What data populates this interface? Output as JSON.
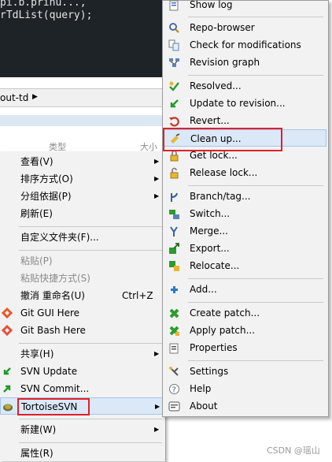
{
  "editor": {
    "line1": "pi.b.prinu..., ",
    "line2": "rTdList(query);"
  },
  "address_bar": {
    "path": "out-td"
  },
  "columns": {
    "type": "类型",
    "size": "大小"
  },
  "context_menu": {
    "view": "查看(V)",
    "sort": "排序方式(O)",
    "group": "分组依据(P)",
    "refresh": "刷新(E)",
    "customize": "自定义文件夹(F)...",
    "paste": "粘贴(P)",
    "paste_shortcut": "粘贴快捷方式(S)",
    "undo_rename": "撤消 重命名(U)",
    "undo_shortcut": "Ctrl+Z",
    "git_gui": "Git GUI Here",
    "git_bash": "Git Bash Here",
    "share": "共享(H)",
    "svn_update": "SVN Update",
    "svn_commit": "SVN Commit...",
    "tortoise": "TortoiseSVN",
    "new": "新建(W)",
    "properties": "属性(R)"
  },
  "submenu": {
    "show_log": "Show log",
    "repo_browser": "Repo-browser",
    "check_mod": "Check for modifications",
    "rev_graph": "Revision graph",
    "resolved": "Resolved...",
    "update_to_rev": "Update to revision...",
    "revert": "Revert...",
    "clean_up": "Clean up...",
    "get_lock": "Get lock...",
    "release_lock": "Release lock...",
    "branch_tag": "Branch/tag...",
    "switch": "Switch...",
    "merge": "Merge...",
    "export": "Export...",
    "relocate": "Relocate...",
    "add": "Add...",
    "create_patch": "Create patch...",
    "apply_patch": "Apply patch...",
    "properties": "Properties",
    "settings": "Settings",
    "help": "Help",
    "about": "About"
  },
  "watermark": "CSDN @瑶山"
}
